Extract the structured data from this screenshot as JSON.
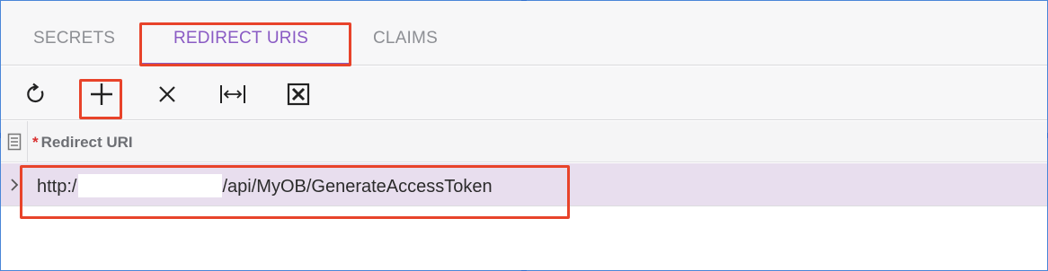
{
  "tabs": [
    {
      "label": "SECRETS",
      "active": false
    },
    {
      "label": "REDIRECT URIS",
      "active": true
    },
    {
      "label": "CLAIMS",
      "active": false
    }
  ],
  "toolbar": {
    "buttons": [
      {
        "name": "refresh",
        "icon": "refresh-icon"
      },
      {
        "name": "add-row",
        "icon": "plus-icon"
      },
      {
        "name": "delete-row",
        "icon": "close-icon"
      },
      {
        "name": "fit-to-screen",
        "icon": "fit-width-icon"
      },
      {
        "name": "export-to-excel",
        "icon": "excel-icon"
      }
    ]
  },
  "grid": {
    "row_header_icon": "file-icon",
    "columns": [
      {
        "label": "Redirect URI",
        "required": true,
        "required_mark": "*"
      }
    ],
    "rows": [
      {
        "uri_prefix": "http:/",
        "uri_suffix": "/api/MyOB/GenerateAccessToken",
        "selected": true
      }
    ]
  },
  "colors": {
    "accent": "#8a5bc4",
    "annotation": "#e8432a",
    "selected_row": "#e8deee",
    "required": "#d93030"
  }
}
